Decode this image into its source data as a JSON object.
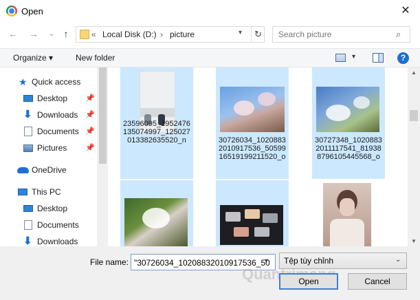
{
  "window": {
    "title": "Open",
    "close_glyph": "✕"
  },
  "nav_buttons": {
    "back": "←",
    "forward": "→",
    "recent": "⌄",
    "up": "↑"
  },
  "address": {
    "overflow": "«",
    "crumbs": [
      "Local Disk (D:)",
      "picture"
    ],
    "separator": "›",
    "refresh_glyph": "↻"
  },
  "search": {
    "placeholder": "Search picture"
  },
  "toolbar": {
    "organize_label": "Organize ▾",
    "new_folder_label": "New folder",
    "help_label": "?"
  },
  "sidebar": {
    "items": [
      {
        "label": "Quick access",
        "icon": "star-icon",
        "pinned": false
      },
      {
        "label": "Desktop",
        "icon": "desktop-icon",
        "pinned": true
      },
      {
        "label": "Downloads",
        "icon": "download-icon",
        "pinned": true
      },
      {
        "label": "Documents",
        "icon": "document-icon",
        "pinned": true
      },
      {
        "label": "Pictures",
        "icon": "pictures-icon",
        "pinned": true
      },
      {
        "label": "OneDrive",
        "icon": "cloud-icon",
        "pinned": false
      },
      {
        "label": "This PC",
        "icon": "computer-icon",
        "pinned": false
      },
      {
        "label": "Desktop",
        "icon": "desktop-icon",
        "pinned": false
      },
      {
        "label": "Documents",
        "icon": "document-icon",
        "pinned": false
      },
      {
        "label": "Downloads",
        "icon": "download-icon",
        "pinned": false
      }
    ]
  },
  "files": [
    {
      "name": "23596095_1952476135074997_125027013382635520_n",
      "selected": true
    },
    {
      "name": "30726034_1020883201091753​6_50599165191992115​20_o",
      "selected": true
    },
    {
      "name": "30727348_1020883201111754​1_819388796105445​568_o",
      "selected": true
    },
    {
      "name": "",
      "selected": true
    },
    {
      "name": "",
      "selected": true
    },
    {
      "name": "",
      "selected": false
    }
  ],
  "bottom": {
    "file_name_label": "File name:",
    "file_name_value": "\"30726034_10208832010917536_50",
    "filter_value": "Tệp tùy chỉnh",
    "open_label": "Open",
    "cancel_label": "Cancel",
    "watermark": "Quantrimang"
  }
}
